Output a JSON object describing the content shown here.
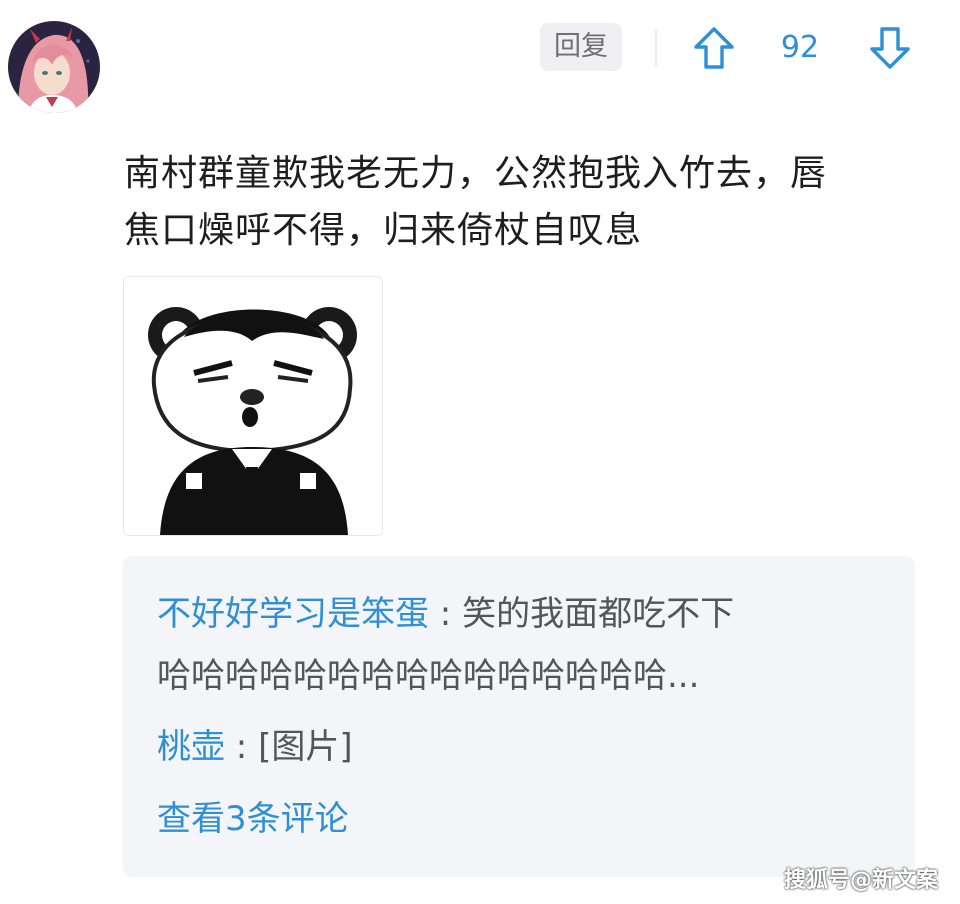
{
  "header": {
    "reply_label": "回复",
    "vote_count": "92",
    "accent_color": "#2d8fd9"
  },
  "comment": {
    "lines": [
      "南村群童欺我老无力，公然抱我入竹去，唇",
      "焦口燥呼不得，归来倚杖自叹息"
    ]
  },
  "replies": {
    "items": [
      {
        "author": "不好好学习是笨蛋",
        "separator": " : ",
        "text_line1": "笑的我面都吃不下",
        "text_line2": "哈哈哈哈哈哈哈哈哈哈哈哈哈哈哈..."
      },
      {
        "author": "桃壶",
        "separator": " : ",
        "text_line1": "[图片]"
      }
    ],
    "see_more": "查看3条评论"
  },
  "watermark": "搜狐号@新文案",
  "icons": {
    "avatar": "user-avatar",
    "upvote": "arrow-up-outline-icon",
    "downvote": "arrow-down-outline-icon",
    "image": "meme-bear-image"
  }
}
